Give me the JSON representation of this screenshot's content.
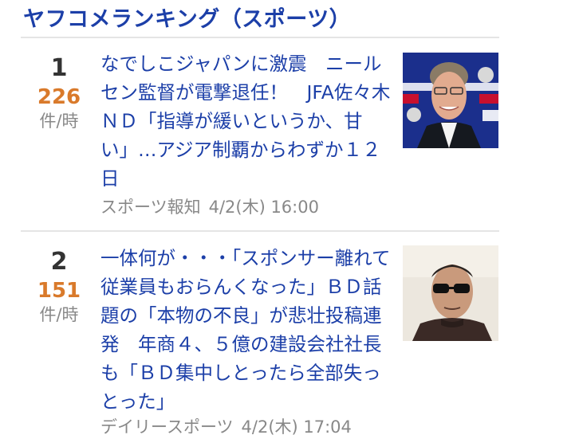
{
  "section": {
    "title": "ヤフコメランキング（スポーツ）"
  },
  "items": [
    {
      "rank": "1",
      "count": "226",
      "unit": "件/時",
      "headline": "なでしこジャパンに激震　ニールセン監督が電撃退任！　JFA佐々木ＮＤ「指導が緩いというか、甘い」…アジア制覇からわずか１２日",
      "source": "スポーツ報知",
      "datetime": "4/2(木) 16:00",
      "thumbnail": "man-in-suit-at-press-conference"
    },
    {
      "rank": "2",
      "count": "151",
      "unit": "件/時",
      "headline": "一体何が・・・「スポンサー離れて従業員もおらんくなった」ＢＤ話題の「本物の不良」が悲壮投稿連発　年商４、５億の建設会社社長も「ＢＤ集中しとったら全部失っとった」",
      "source": "デイリースポーツ",
      "datetime": "4/2(木) 17:04",
      "thumbnail": "man-in-sunglasses"
    }
  ],
  "colors": {
    "accent": "#1c3fa8",
    "count": "#d97a2b",
    "muted": "#888888",
    "rank": "#333333"
  }
}
